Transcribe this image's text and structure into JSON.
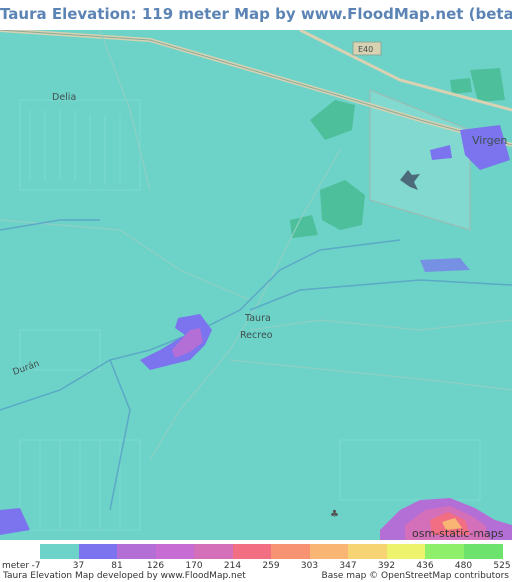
{
  "title": "Taura Elevation: 119 meter Map by www.FloodMap.net (beta)",
  "colors": {
    "base": "#6dd3c8",
    "low": "#7b74ee",
    "mid": "#b46fd6",
    "road": "#d8d2b2",
    "roadline": "#8aaa9a",
    "water": "#5aa9c6",
    "green": "#4dbf9a"
  },
  "places": {
    "delia": "Delia",
    "virgen": "Virgen",
    "taura": "Taura",
    "recreo": "Recreo",
    "duran": "Durán",
    "road_e40": "E40"
  },
  "map_credit": "osm-static-maps",
  "legend": {
    "unit": "meter",
    "colors": [
      "#6dd3c8",
      "#7b74ee",
      "#b46fd6",
      "#c76cd2",
      "#d46fb9",
      "#f16e83",
      "#f79373",
      "#f8b574",
      "#f6d373",
      "#eef36e",
      "#8ef06a",
      "#6de36d"
    ],
    "ticks": [
      "-7",
      "37",
      "81",
      "126",
      "170",
      "214",
      "259",
      "303",
      "347",
      "392",
      "436",
      "480",
      "525"
    ]
  },
  "footer": {
    "left": "Taura Elevation Map developed by www.FloodMap.net",
    "right": "Base map © OpenStreetMap contributors"
  }
}
